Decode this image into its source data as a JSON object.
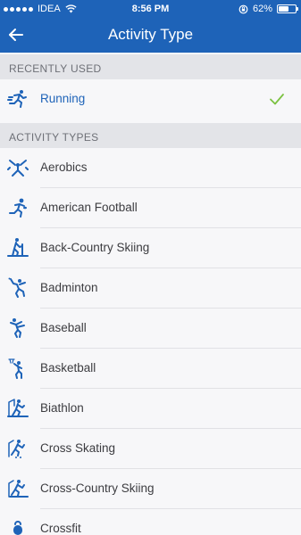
{
  "status_bar": {
    "carrier": "IDEA",
    "time": "8:56 PM",
    "battery": "62%",
    "battery_level": 0.62
  },
  "header": {
    "title": "Activity Type"
  },
  "recently_used": {
    "header": "RECENTLY USED",
    "items": [
      {
        "label": "Running",
        "icon": "running-icon",
        "selected": true
      }
    ]
  },
  "activity_types": {
    "header": "ACTIVITY TYPES",
    "items": [
      {
        "label": "Aerobics",
        "icon": "aerobics-icon"
      },
      {
        "label": "American Football",
        "icon": "american-football-icon"
      },
      {
        "label": "Back-Country Skiing",
        "icon": "back-country-skiing-icon"
      },
      {
        "label": "Badminton",
        "icon": "badminton-icon"
      },
      {
        "label": "Baseball",
        "icon": "baseball-icon"
      },
      {
        "label": "Basketball",
        "icon": "basketball-icon"
      },
      {
        "label": "Biathlon",
        "icon": "biathlon-icon"
      },
      {
        "label": "Cross Skating",
        "icon": "cross-skating-icon"
      },
      {
        "label": "Cross-Country Skiing",
        "icon": "cross-country-skiing-icon"
      },
      {
        "label": "Crossfit",
        "icon": "crossfit-icon"
      }
    ]
  },
  "colors": {
    "accent": "#1e63b8",
    "check": "#7cc242"
  }
}
